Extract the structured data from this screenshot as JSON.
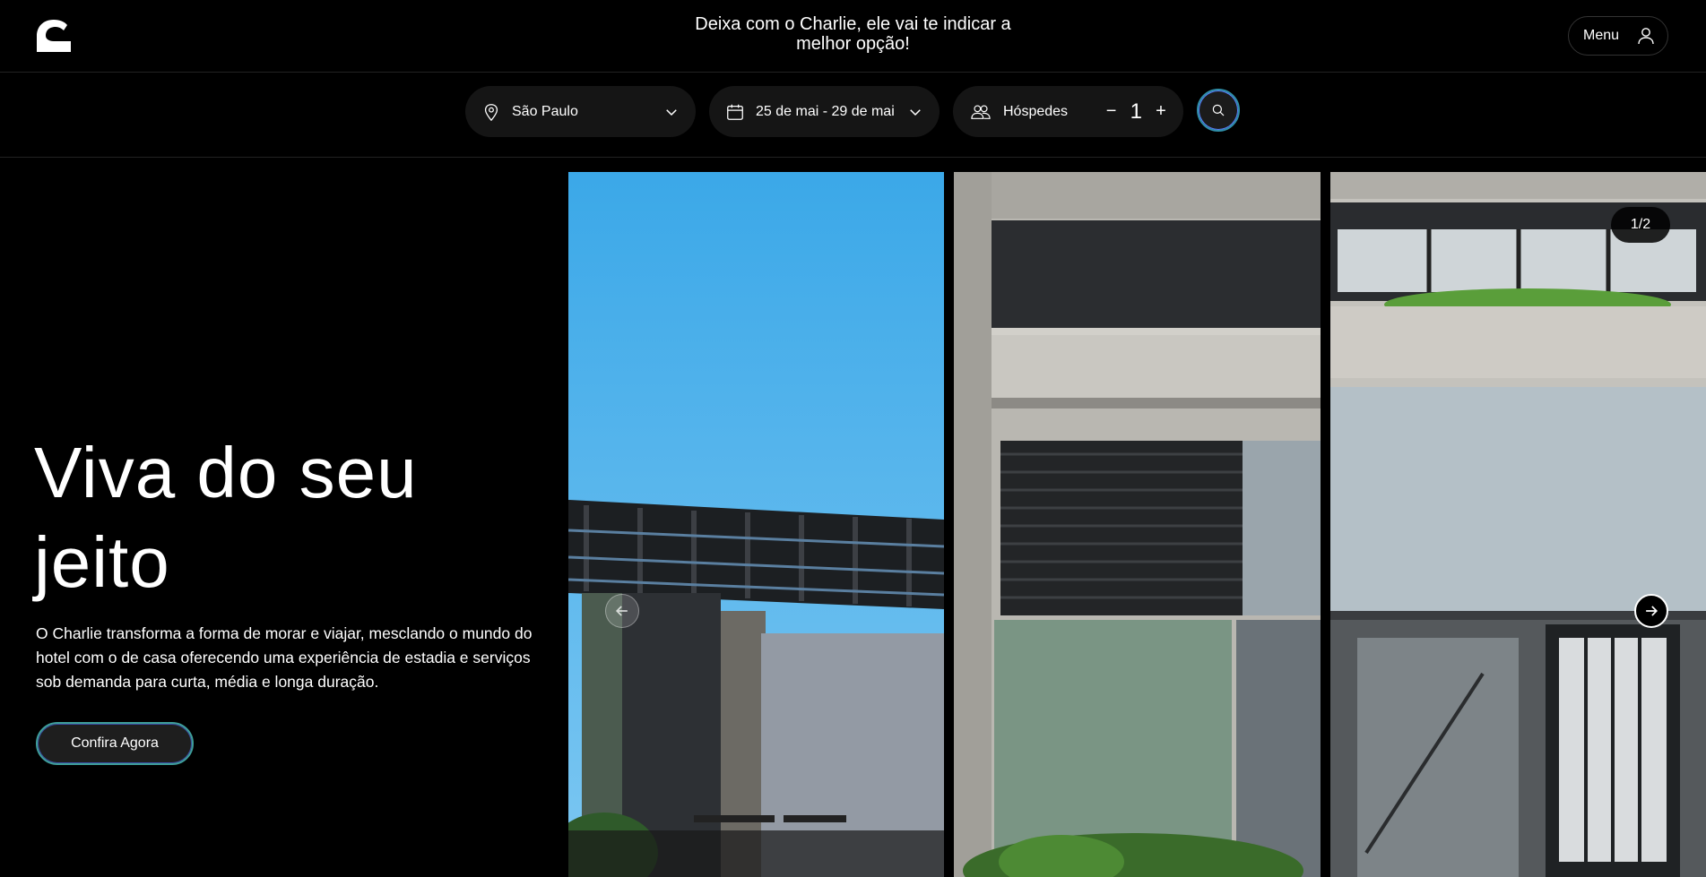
{
  "header": {
    "logo": "charlie-logo",
    "tagline": "Deixa com o Charlie, ele vai te indicar a melhor opção!",
    "menu_label": "Menu"
  },
  "search": {
    "location": "São Paulo",
    "dates": "25 de mai - 29 de mai",
    "guests_label": "Hóspedes",
    "guests_count": "1",
    "decrement": "−",
    "increment": "+"
  },
  "hero": {
    "title": "Viva do seu jeito",
    "description": "O Charlie transforma a forma de morar e viajar, mesclando o mundo do hotel com o de casa oferecendo uma experiência de estadia e serviços sob demanda para curta, média e longa duração.",
    "cta_label": "Confira Agora"
  },
  "gallery": {
    "counter": "1/2",
    "images": [
      "building-pergola-sky",
      "building-facade-concrete",
      "building-glass-entrance"
    ]
  },
  "colors": {
    "background": "#000000",
    "accent_teal": "#3e9e9a",
    "accent_blue": "#3a4aa0",
    "sky": "#4fb3ec"
  }
}
